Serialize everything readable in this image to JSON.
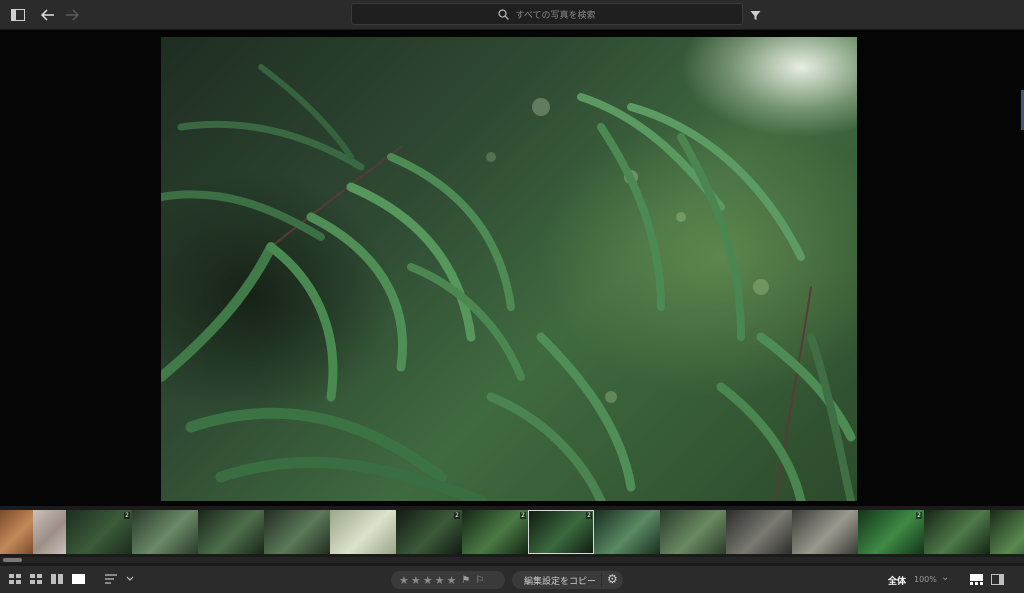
{
  "search": {
    "placeholder": "すべての写真を検索"
  },
  "toolbar_top": {
    "sidebar_toggle_icon": "sidebar-icon",
    "back_icon": "arrow-left-icon",
    "forward_icon": "arrow-right-icon",
    "filter_icon": "filter-icon"
  },
  "filmstrip": {
    "thumbs": [
      {
        "badge": "",
        "colors": [
          "#7a4a2a",
          "#c28a5a"
        ]
      },
      {
        "badge": "",
        "colors": [
          "#c9c2bc",
          "#9c8e84"
        ]
      },
      {
        "badge": "2",
        "colors": [
          "#1c2c1e",
          "#3b5c3a"
        ]
      },
      {
        "badge": "",
        "colors": [
          "#2a3a2a",
          "#6a8a68"
        ]
      },
      {
        "badge": "",
        "colors": [
          "#1a261a",
          "#4d6e4a"
        ]
      },
      {
        "badge": "",
        "colors": [
          "#222c22",
          "#5b7a58"
        ]
      },
      {
        "badge": "",
        "colors": [
          "#9aa68a",
          "#dce2cc"
        ]
      },
      {
        "badge": "2",
        "colors": [
          "#121a12",
          "#3c5a3a"
        ]
      },
      {
        "badge": "2",
        "colors": [
          "#142614",
          "#4a7a44"
        ]
      },
      {
        "badge": "2",
        "colors": [
          "#0e1a10",
          "#3a6a3e"
        ]
      },
      {
        "badge": "",
        "colors": [
          "#1a2e20",
          "#5a8a64"
        ]
      },
      {
        "badge": "",
        "colors": [
          "#2a3a2a",
          "#6a8a62"
        ]
      },
      {
        "badge": "",
        "colors": [
          "#2c2c2c",
          "#7a7a72"
        ]
      },
      {
        "badge": "",
        "colors": [
          "#3a3a36",
          "#9a9a90"
        ]
      },
      {
        "badge": "2",
        "colors": [
          "#14341a",
          "#3e8a44"
        ]
      },
      {
        "badge": "",
        "colors": [
          "#162416",
          "#4e7a48"
        ]
      },
      {
        "badge": "",
        "colors": [
          "#1a2a18",
          "#5a8a50"
        ]
      }
    ],
    "selected_index": 9
  },
  "bottombar": {
    "view_icons": [
      "grid-small-icon",
      "grid-medium-icon",
      "compare-icon",
      "single-view-icon"
    ],
    "sort_icon": "sort-icon",
    "rating_stars": 5,
    "copy_settings_label": "編集設定をコピー",
    "zoom_fit_label": "全体",
    "zoom_percent": "100%"
  }
}
